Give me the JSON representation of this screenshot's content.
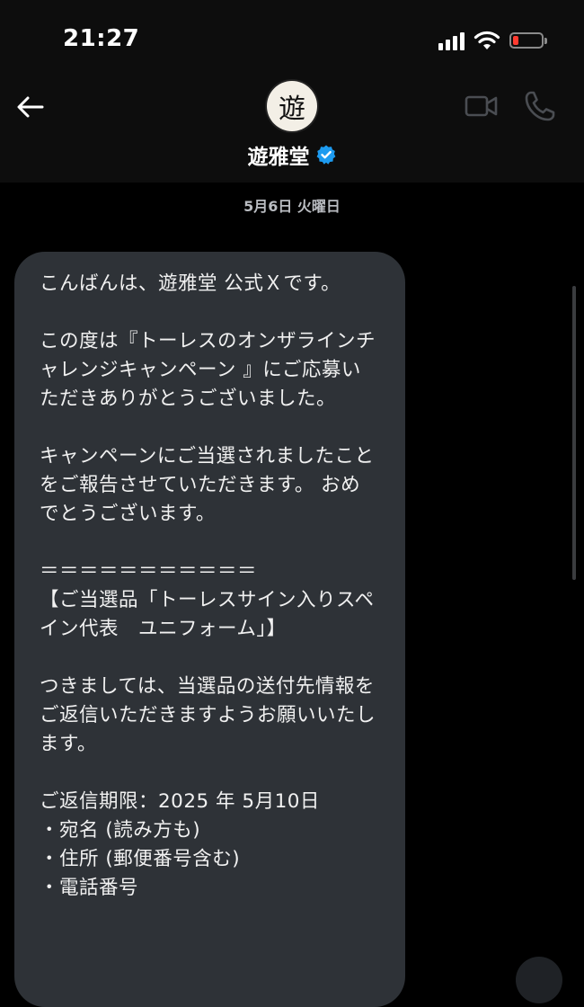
{
  "status_bar": {
    "time": "21:27",
    "battery_level": 0.2,
    "battery_color": "#ff3b30"
  },
  "header": {
    "avatar_glyph": "遊",
    "contact_name": "遊雅堂",
    "verified": true,
    "verified_color": "#1d9bf0",
    "icons": [
      "back-arrow-icon",
      "video-call-icon",
      "phone-icon",
      "verified-badge-icon"
    ]
  },
  "conversation": {
    "date_separator": "5月6日 火曜日",
    "messages": [
      {
        "direction": "incoming",
        "text": "こんばんは、遊雅堂 公式Ｘです。\n\nこの度は『トーレスのオンザラインチャレンジキャンペーン 』にご応募いただきありがとうございました。\n\nキャンペーンにご当選されましたことをご報告させていただきます。 おめでとうございます。\n\n＝＝＝＝＝＝＝＝＝＝＝\n【ご当選品「トーレスサイン入りスペイン代表　ユニフォーム」】\n\nつきましては、当選品の送付先情報をご返信いただきますようお願いいたします。\n\nご返信期限：2025 年 5月10日\n・宛名 (読み方も)\n・住所 (郵便番号含む)\n・電話番号"
      }
    ]
  },
  "colors": {
    "background": "#000000",
    "header_background": "#0d0d0d",
    "bubble_background": "#2e3237",
    "date_text": "#b9bcc1"
  }
}
